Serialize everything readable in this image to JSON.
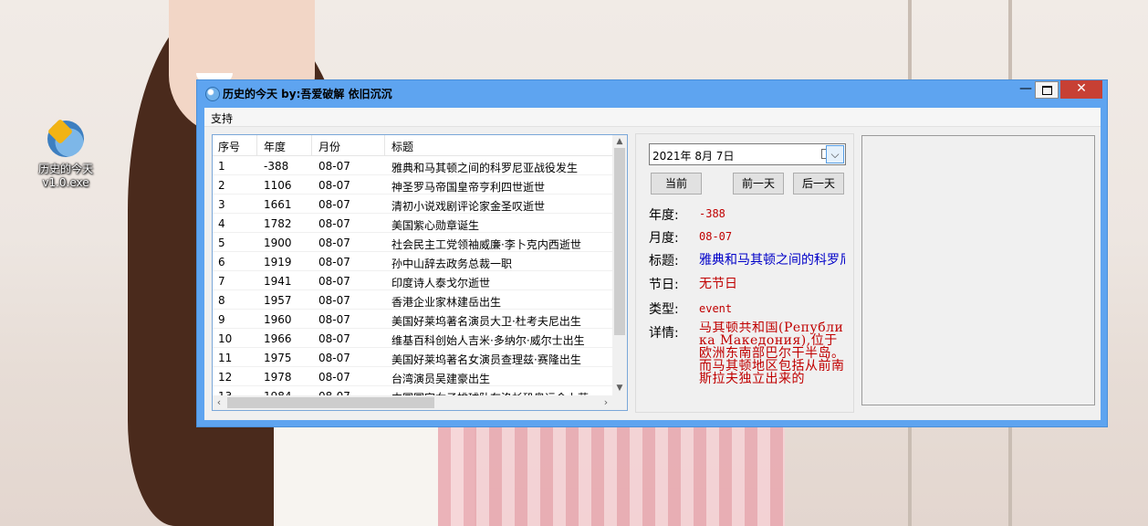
{
  "desktop": {
    "icon_label": "历史的今天 v1.0.exe"
  },
  "window": {
    "title": "历史的今天 by:吾爱破解 依旧沉沉",
    "minimize_glyph": "—",
    "close_glyph": "✕",
    "menu": [
      "支持"
    ]
  },
  "list": {
    "columns": [
      "序号",
      "年度",
      "月份",
      "标题"
    ],
    "rows": [
      [
        "1",
        "-388",
        "08-07",
        "雅典和马其顿之间的科罗尼亚战役发生"
      ],
      [
        "2",
        "1106",
        "08-07",
        "神圣罗马帝国皇帝亨利四世逝世"
      ],
      [
        "3",
        "1661",
        "08-07",
        "清初小说戏剧评论家金圣叹逝世"
      ],
      [
        "4",
        "1782",
        "08-07",
        "美国紫心勋章诞生"
      ],
      [
        "5",
        "1900",
        "08-07",
        "社会民主工党领袖威廉·李卜克内西逝世"
      ],
      [
        "6",
        "1919",
        "08-07",
        "孙中山辞去政务总裁一职"
      ],
      [
        "7",
        "1941",
        "08-07",
        "印度诗人泰戈尔逝世"
      ],
      [
        "8",
        "1957",
        "08-07",
        "香港企业家林建岳出生"
      ],
      [
        "9",
        "1960",
        "08-07",
        "美国好莱坞著名演员大卫·杜考夫尼出生"
      ],
      [
        "10",
        "1966",
        "08-07",
        "维基百科创始人吉米·多纳尔·威尔士出生"
      ],
      [
        "11",
        "1975",
        "08-07",
        "美国好莱坞著名女演员查理兹·赛隆出生"
      ],
      [
        "12",
        "1978",
        "08-07",
        "台湾演员吴建豪出生"
      ],
      [
        "13",
        "1984",
        "08-07",
        "中国国家女子排球队在洛杉矶奥运会上获"
      ]
    ]
  },
  "date_picker": {
    "value": "2021年  8月  7日",
    "dropdown_glyph": "⌵"
  },
  "buttons": {
    "current": "当前",
    "prev_day": "前一天",
    "next_day": "后一天"
  },
  "details": {
    "year_label": "年度:",
    "year_value": "-388",
    "month_label": "月度:",
    "month_value": "08-07",
    "title_label": "标题:",
    "title_value": "雅典和马其顿之间的科罗尼亚战役发生",
    "festival_label": "节日:",
    "festival_value": "无节日",
    "type_label": "类型:",
    "type_value": "event",
    "detail_label": "详情:",
    "detail_value": "马其顿共和国(Република Македония),位于欧洲东南部巴尔干半岛。而马其顿地区包括从前南斯拉夫独立出来的"
  },
  "colors": {
    "window_frame": "#5ea4f0",
    "close_button": "#c74034",
    "value_red": "#c00000",
    "title_blue": "#0000c8"
  }
}
